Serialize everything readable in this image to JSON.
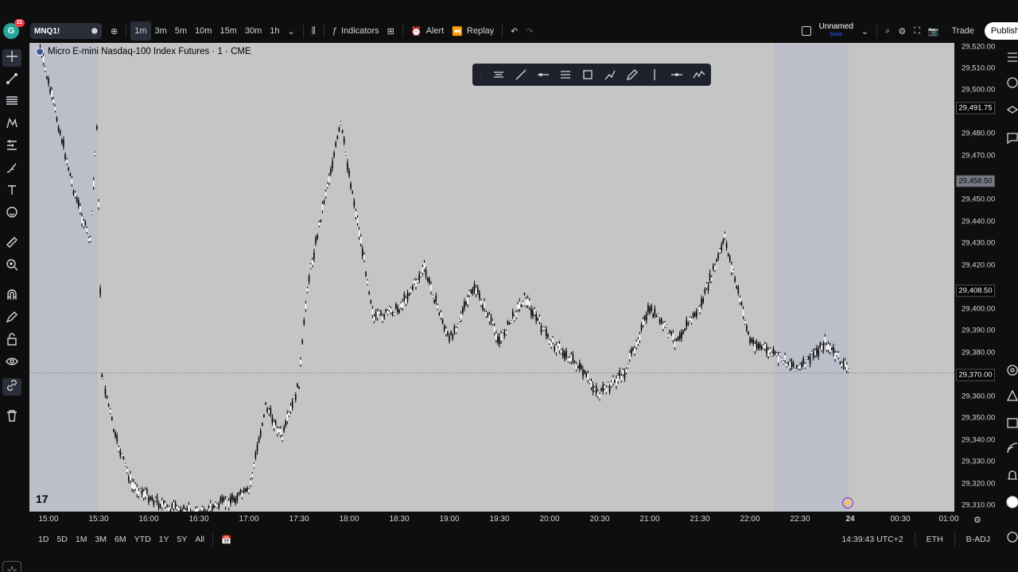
{
  "topbar": {
    "avatar_letter": "G",
    "avatar_badge": "11",
    "symbol": "MNQ1!",
    "timeframes": [
      "1m",
      "3m",
      "5m",
      "10m",
      "15m",
      "30m",
      "1h"
    ],
    "active_timeframe": "1m",
    "indicators_label": "Indicators",
    "alert_label": "Alert",
    "replay_label": "Replay",
    "layout_name": "Unnamed",
    "layout_status": "Save",
    "trade_label": "Trade",
    "publish_label": "Publish"
  },
  "chart": {
    "title": "Micro E-mini Nasdaq-100 Index Futures · 1 · CME",
    "logo_text": "17",
    "price_ticks": [
      "29,520.00",
      "29,510.00",
      "29,500.00",
      "29,480.00",
      "29,470.00",
      "29,450.00",
      "29,440.00",
      "29,430.00",
      "29,420.00",
      "29,400.00",
      "29,390.00",
      "29,380.00",
      "29,360.00",
      "29,350.00",
      "29,340.00",
      "29,330.00",
      "29,320.00",
      "29,310.00"
    ],
    "price_labels": [
      {
        "text": "29,491.75",
        "style": "dark"
      },
      {
        "text": "29,458.50",
        "style": "gray"
      },
      {
        "text": "29,408.50",
        "style": "dark"
      },
      {
        "text": "29,370.00",
        "style": "dark"
      }
    ],
    "time_ticks": [
      "15:00",
      "15:30",
      "16:00",
      "16:30",
      "17:00",
      "17:30",
      "18:00",
      "18:30",
      "19:00",
      "19:30",
      "20:00",
      "20:30",
      "21:00",
      "21:30",
      "22:00",
      "22:30",
      "24",
      "00:30",
      "01:00"
    ]
  },
  "chart_data": {
    "type": "candlestick",
    "title": "Micro E-mini Nasdaq-100 Index Futures · 1 · CME",
    "xlabel": "",
    "ylabel": "",
    "ylim": [
      29305,
      29522
    ],
    "x_range": [
      "14:55",
      "01:00"
    ],
    "last_price": 29370.0,
    "grid": false,
    "price_path": [
      {
        "t": "14:55",
        "p": 29520
      },
      {
        "t": "15:05",
        "p": 29488
      },
      {
        "t": "15:15",
        "p": 29455
      },
      {
        "t": "15:25",
        "p": 29430
      },
      {
        "t": "15:29",
        "p": 29485
      },
      {
        "t": "15:32",
        "p": 29370
      },
      {
        "t": "15:40",
        "p": 29340
      },
      {
        "t": "15:50",
        "p": 29318
      },
      {
        "t": "16:10",
        "p": 29308
      },
      {
        "t": "16:30",
        "p": 29305
      },
      {
        "t": "17:00",
        "p": 29315
      },
      {
        "t": "17:10",
        "p": 29355
      },
      {
        "t": "17:20",
        "p": 29340
      },
      {
        "t": "17:30",
        "p": 29365
      },
      {
        "t": "17:35",
        "p": 29410
      },
      {
        "t": "17:45",
        "p": 29450
      },
      {
        "t": "17:55",
        "p": 29485
      },
      {
        "t": "18:05",
        "p": 29440
      },
      {
        "t": "18:15",
        "p": 29395
      },
      {
        "t": "18:30",
        "p": 29400
      },
      {
        "t": "18:45",
        "p": 29418
      },
      {
        "t": "19:00",
        "p": 29385
      },
      {
        "t": "19:15",
        "p": 29410
      },
      {
        "t": "19:30",
        "p": 29385
      },
      {
        "t": "19:45",
        "p": 29405
      },
      {
        "t": "20:00",
        "p": 29385
      },
      {
        "t": "20:15",
        "p": 29375
      },
      {
        "t": "20:30",
        "p": 29360
      },
      {
        "t": "20:45",
        "p": 29370
      },
      {
        "t": "21:00",
        "p": 29400
      },
      {
        "t": "21:15",
        "p": 29385
      },
      {
        "t": "21:30",
        "p": 29400
      },
      {
        "t": "21:45",
        "p": 29432
      },
      {
        "t": "22:00",
        "p": 29385
      },
      {
        "t": "22:15",
        "p": 29378
      },
      {
        "t": "22:30",
        "p": 29372
      },
      {
        "t": "22:45",
        "p": 29384
      },
      {
        "t": "23:00",
        "p": 29370
      }
    ],
    "sessions_highlighted": [
      [
        "14:55",
        "15:30"
      ],
      [
        "22:15",
        "23:00"
      ]
    ]
  },
  "bottombar": {
    "ranges": [
      "1D",
      "5D",
      "1M",
      "3M",
      "6M",
      "YTD",
      "1Y",
      "5Y",
      "All"
    ],
    "clock": "14:39:43 UTC+2",
    "session": "ETH",
    "adjust": "B-ADJ"
  }
}
